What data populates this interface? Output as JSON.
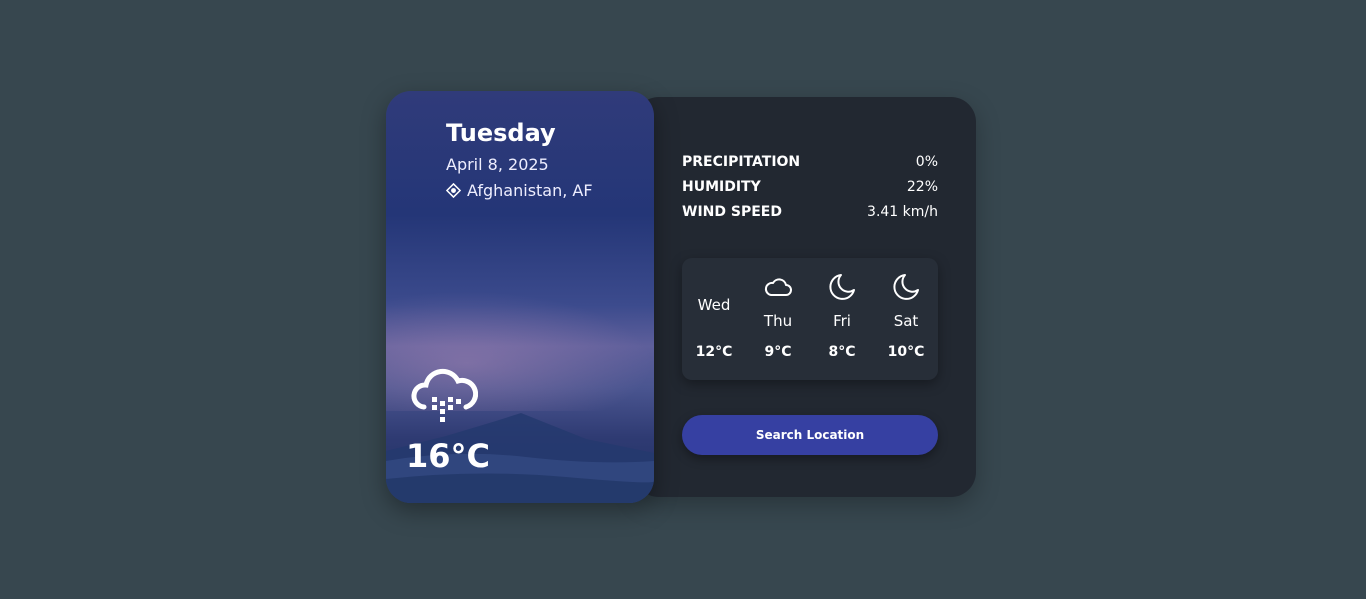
{
  "today": {
    "day": "Tuesday",
    "date": "April 8, 2025",
    "location": "Afghanistan, AF",
    "temperature": "16°C",
    "icon": "cloud-rain-icon"
  },
  "stats": [
    {
      "label": "PRECIPITATION",
      "value": "0%"
    },
    {
      "label": "HUMIDITY",
      "value": "22%"
    },
    {
      "label": "WIND SPEED",
      "value": "3.41 km/h"
    }
  ],
  "forecast": [
    {
      "day": "Wed",
      "temp": "12°C",
      "icon": ""
    },
    {
      "day": "Thu",
      "temp": "9°C",
      "icon": "cloud-icon"
    },
    {
      "day": "Fri",
      "temp": "8°C",
      "icon": "moon-icon"
    },
    {
      "day": "Sat",
      "temp": "10°C",
      "icon": "moon-icon"
    }
  ],
  "search_button": {
    "label": "Search Location"
  },
  "colors": {
    "background": "#37474f",
    "panel": "#222831",
    "forecast_box": "#272e38",
    "button": "#3640a2"
  }
}
